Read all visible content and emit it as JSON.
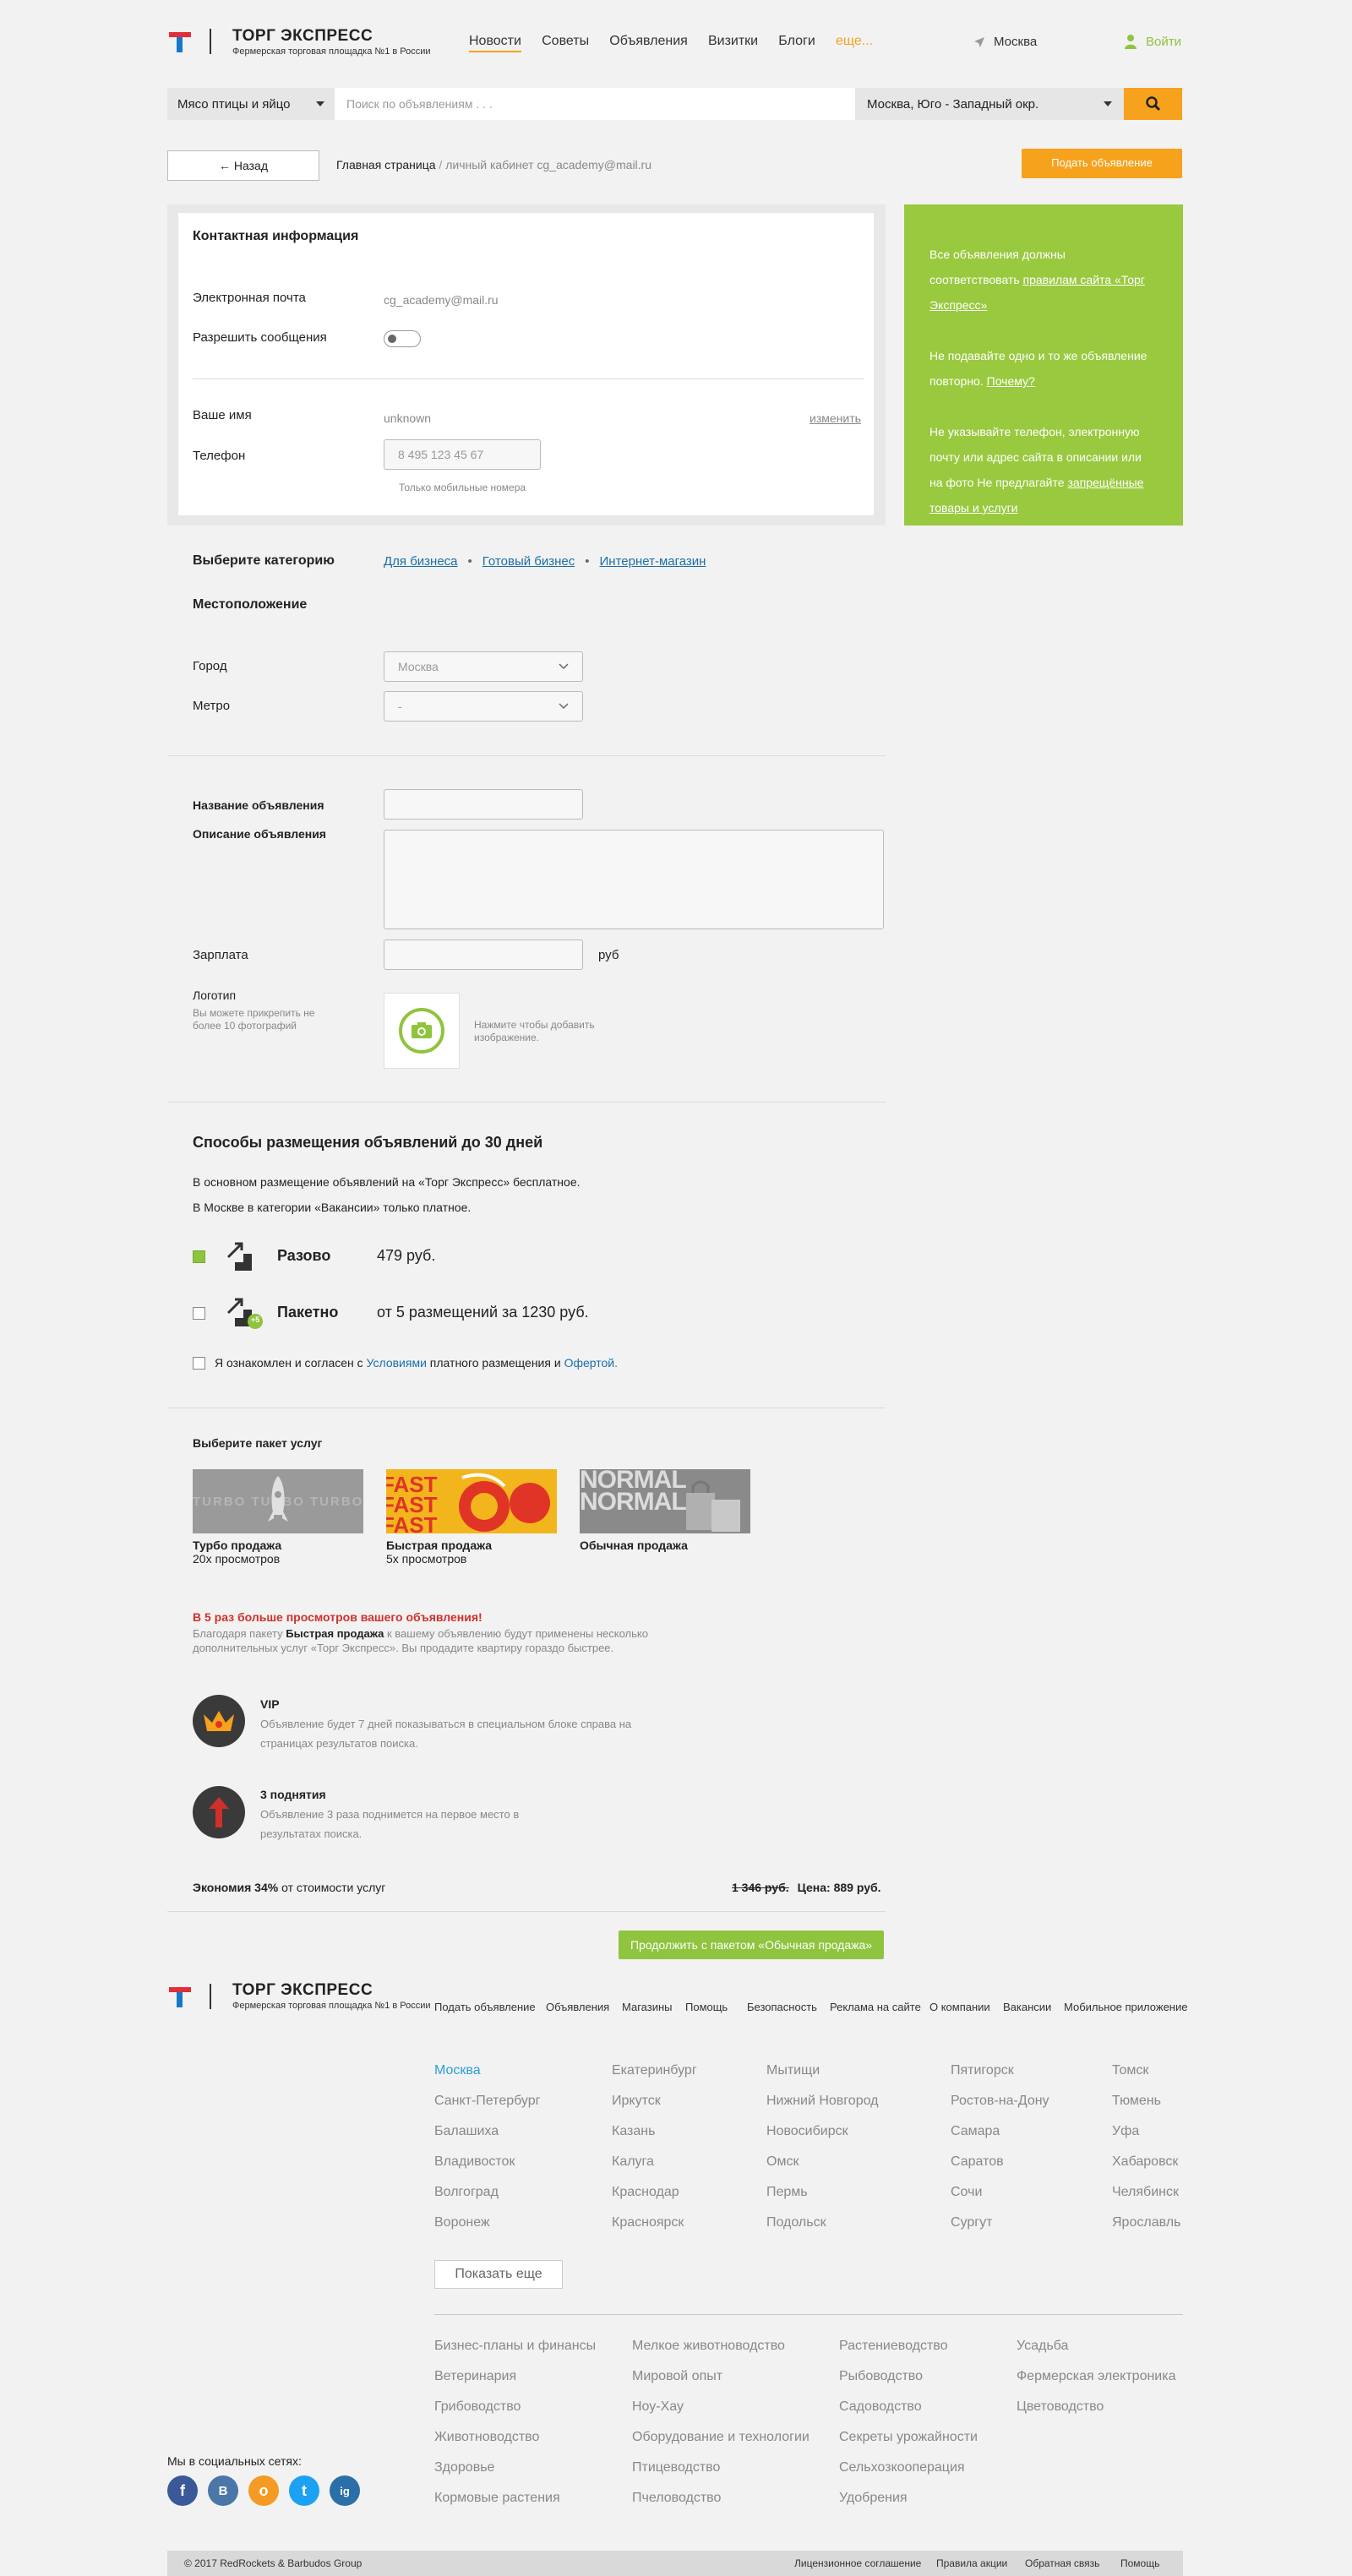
{
  "header": {
    "brand_title": "ТОРГ ЭКСПРЕСС",
    "brand_sub": "Фермерская торговая площадка №1 в России",
    "nav": [
      "Новости",
      "Советы",
      "Объявления",
      "Визитки",
      "Блоги",
      "еще..."
    ],
    "location": "Москва",
    "login": "Войти"
  },
  "search": {
    "category": "Мясо птицы и яйцо",
    "placeholder": "Поиск по объявлениям . . .",
    "region": "Москва, Юго - Западный окр."
  },
  "toolbar": {
    "back": "← Назад",
    "breadcrumb_home": "Главная страница",
    "breadcrumb_sep": " / ",
    "breadcrumb_current": "личный кабинет cg_academy@mail.ru",
    "submit_ad": "Подать объявление"
  },
  "contact": {
    "title": "Контактная информация",
    "email_label": "Электронная почта",
    "email_value": "cg_academy@mail.ru",
    "allow_messages_label": "Разрешить сообщения",
    "name_label": "Ваше имя",
    "name_value": "unknown",
    "edit": "изменить",
    "phone_label": "Телефон",
    "phone_value": "8 495 123 45 67",
    "phone_hint": "Только мобильные номера"
  },
  "sidebar": {
    "p1_text": "Все объявления должны соответствовать",
    "p1_link": "правилам сайта «Торг Экспресс»",
    "p2_text": "Не подавайте одно и то же объявление повторно.",
    "p2_link": "Почему?",
    "p3_text": "Не указывайте телефон, электронную почту или адрес сайта в описании или на фото Не предлагайте",
    "p3_link": "запрещённые товары и услуги"
  },
  "category": {
    "label": "Выберите категорию",
    "crumbs": [
      "Для бизнеса",
      "Готовый бизнес",
      "Интернет-магазин"
    ]
  },
  "location": {
    "title": "Местоположение",
    "city_label": "Город",
    "city_value": "Москва",
    "metro_label": "Метро",
    "metro_value": "-"
  },
  "ad": {
    "title_label": "Название объявления",
    "desc_label": "Описание объявления",
    "salary_label": "Зарплата",
    "salary_unit": "руб",
    "logo_label": "Логотип",
    "logo_hint": "Вы можете прикрепить не более 10 фотографий",
    "upload_hint": "Нажмите чтобы добавить изображение."
  },
  "placement": {
    "title": "Способы размещения объявлений до 30 дней",
    "line1": "В основном размещение объявлений на «Торг Экспресс» бесплатное.",
    "line2": "В Москве в категории «Вакансии» только платное.",
    "once_name": "Разово",
    "once_price": "479 руб.",
    "package_name": "Пакетно",
    "package_badge": "+5",
    "package_price": "от 5 размещений за 1230 руб.",
    "agree_pre": "Я ознакомлен и согласен с",
    "agree_terms": "Условиями",
    "agree_mid": "платного размещения и",
    "agree_offer": "Офертой."
  },
  "packages": {
    "title": "Выберите пакет услуг",
    "items": [
      {
        "name": "Турбо продажа",
        "views": "20x просмотров",
        "thumb_text": "TURBO TURBO TURBO"
      },
      {
        "name": "Быстрая продажа",
        "views": "5x просмотров",
        "thumb_text": "FAST FAST FAST"
      },
      {
        "name": "Обычная продажа",
        "views": "",
        "thumb_text": "NORMAL NORMAL"
      }
    ],
    "promo_title": "В 5 раз больше просмотров вашего объявления!",
    "promo_pre": "Благодаря пакету",
    "promo_bold": "Быстрая продажа",
    "promo_post": "к вашему объявлению будут применены несколько дополнительных услуг «Торг Экспресс». Вы продадите квартиру гораздо быстрее."
  },
  "services": [
    {
      "name": "VIP",
      "desc": "Объявление будет 7 дней показываться в специальном блоке справа на страницах результатов поиска."
    },
    {
      "name": "3 поднятия",
      "desc": "Объявление 3 раза поднимется на первое место в результатах поиска."
    }
  ],
  "summary": {
    "saving_bold": "Экономия 34%",
    "saving_rest": "от стоимости услуг",
    "old_price": "1 346 руб.",
    "new_price": "Цена: 889 руб.",
    "continue": "Продолжить с пакетом «Обычная продажа»"
  },
  "footer": {
    "nav": [
      "Подать объявление",
      "Объявления",
      "Магазины",
      "Помощь",
      "Безопасность",
      "Реклама на сайте",
      "О компании",
      "Вакансии",
      "Мобильное приложение"
    ],
    "cities": [
      [
        "Москва",
        "Санкт-Петербург",
        "Балашиха",
        "Владивосток",
        "Волгоград",
        "Воронеж"
      ],
      [
        "Екатеринбург",
        "Иркутск",
        "Казань",
        "Калуга",
        "Краснодар",
        "Красноярск"
      ],
      [
        "Мытищи",
        "Нижний Новгород",
        "Новосибирск",
        "Омск",
        "Пермь",
        "Подольск"
      ],
      [
        "Пятигорск",
        "Ростов-на-Дону",
        "Самара",
        "Саратов",
        "Сочи",
        "Сургут"
      ],
      [
        "Томск",
        "Тюмень",
        "Уфа",
        "Хабаровск",
        "Челябинск",
        "Ярославль"
      ]
    ],
    "show_more": "Показать еще",
    "topics": [
      [
        "Бизнес-планы и финансы",
        "Ветеринария",
        "Грибоводство",
        "Животноводство",
        "Здоровье",
        "Кормовые растения"
      ],
      [
        "Мелкое животноводство",
        "Мировой опыт",
        "Ноу-Хау",
        "Оборудование и технологии",
        "Птицеводство",
        "Пчеловодство"
      ],
      [
        "Растениеводство",
        "Рыбоводство",
        "Садоводство",
        "Секреты урожайности",
        "Сельхозкооперация",
        "Удобрения"
      ],
      [
        "Усадьба",
        "Фермерская электроника",
        "Цветоводство"
      ]
    ],
    "social_label": "Мы в социальных сетях:",
    "social": [
      "f",
      "В",
      "о",
      "t",
      "ig"
    ],
    "copyright": "© 2017 RedRockets & Barbudos Group",
    "bottom_links": [
      "Лицензионное соглашение",
      "Правила акции",
      "Обратная связь",
      "Помощь"
    ]
  },
  "colors": {
    "accent": "#f6a21d",
    "green": "#99c93f",
    "link": "#1a6fa8",
    "red": "#d0302b"
  }
}
